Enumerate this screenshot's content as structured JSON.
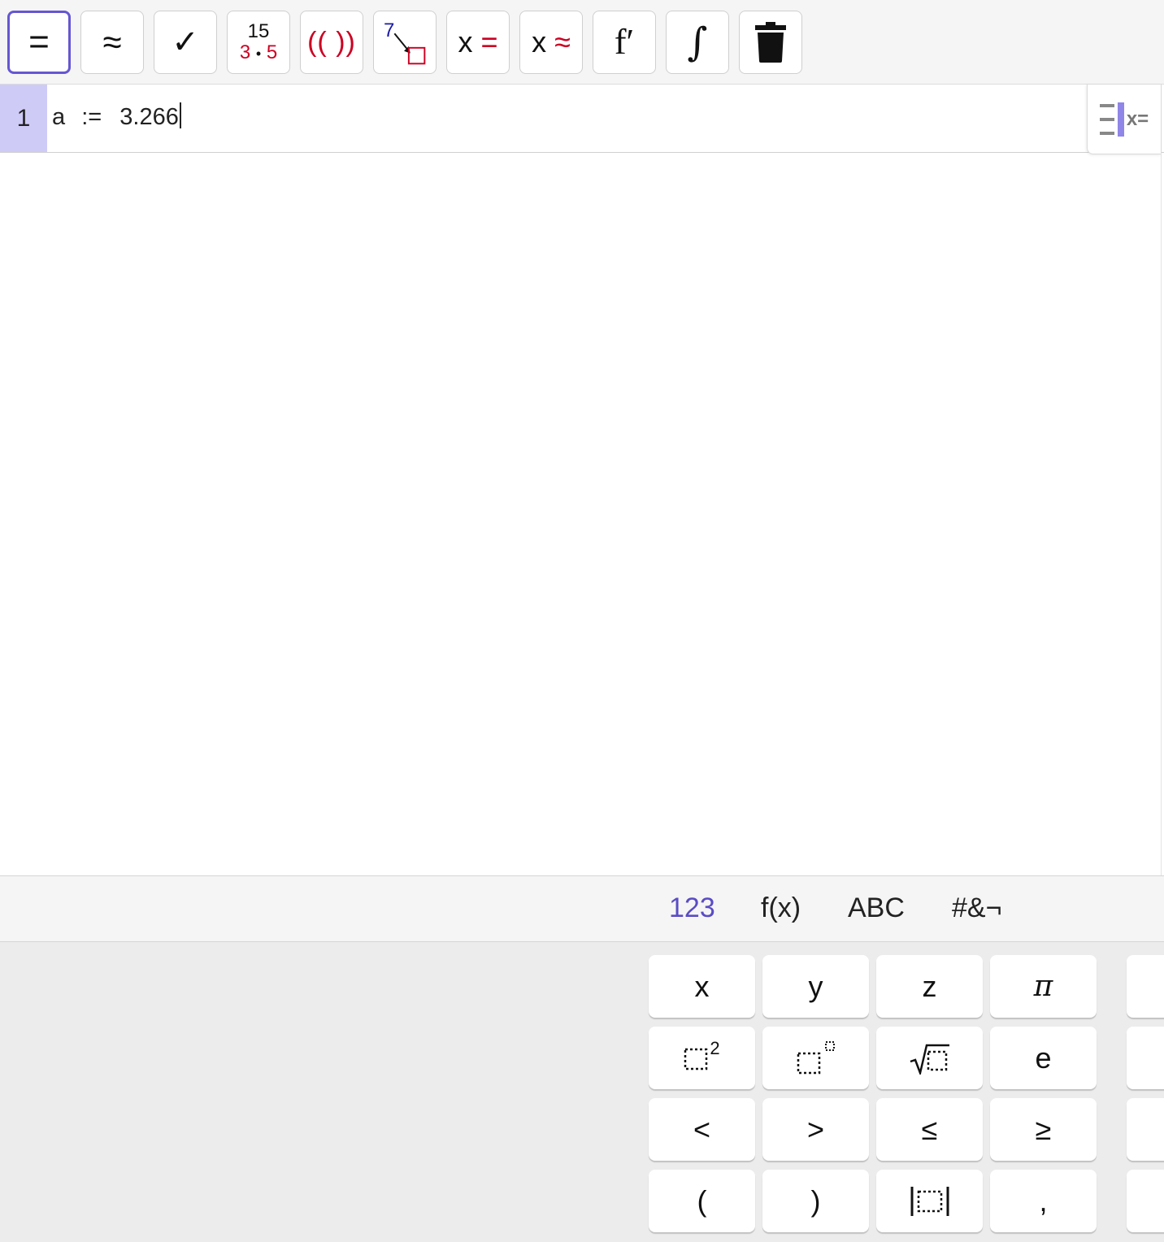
{
  "toolbar": {
    "tools": [
      {
        "name": "evaluate",
        "label": "="
      },
      {
        "name": "numeric",
        "label": "≈"
      },
      {
        "name": "keep-input",
        "label": "✓"
      },
      {
        "name": "factor",
        "top": "15",
        "bottom_left": "3",
        "bottom_dot": "•",
        "bottom_right": "5"
      },
      {
        "name": "expand",
        "label_open": "((",
        "label_close": "))"
      },
      {
        "name": "substitute",
        "label": "7"
      },
      {
        "name": "solve",
        "var": "x",
        "op": "="
      },
      {
        "name": "solve-numerically",
        "var": "x",
        "op": "≈"
      },
      {
        "name": "derivative",
        "label": "f′"
      },
      {
        "name": "integral",
        "label": "∫"
      },
      {
        "name": "delete",
        "icon": "trash-icon"
      }
    ],
    "accent_color": "#6557d2",
    "red_color": "#cc0022",
    "blue_color": "#1a1aa6"
  },
  "algebra": {
    "rows": [
      {
        "number": "1",
        "name_part": "a",
        "assign": ":=",
        "value": "3.266"
      }
    ],
    "row_button_label": "x="
  },
  "keyboard": {
    "tabs": [
      "123",
      "f(x)",
      "ABC",
      "#&¬"
    ],
    "active_tab": "123",
    "keys": {
      "x": "x",
      "y": "y",
      "z": "z",
      "pi": "π",
      "square_exp": "2",
      "e": "e",
      "lt": "<",
      "gt": ">",
      "le": "≤",
      "ge": "≥",
      "lparen": "(",
      "rparen": ")",
      "comma": ","
    }
  }
}
